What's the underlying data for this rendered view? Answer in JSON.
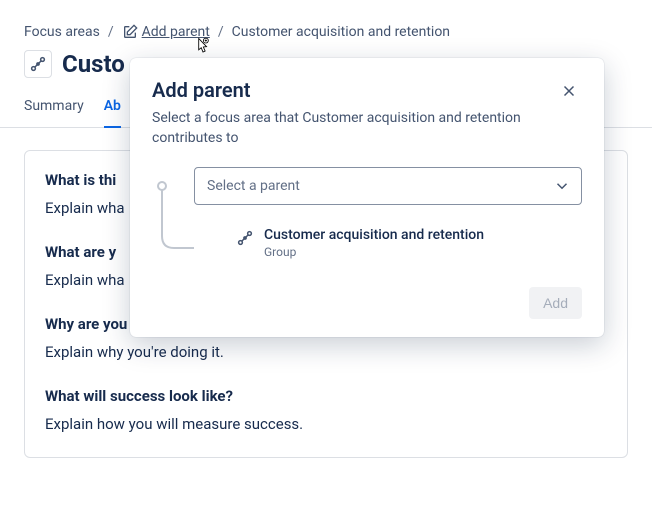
{
  "breadcrumb": {
    "root": "Focus areas",
    "add_parent": "Add parent",
    "current": "Customer acquisition and retention"
  },
  "title": "Customer acquisition and retention",
  "title_truncated": "Custo",
  "tabs": {
    "summary": "Summary",
    "about": "About",
    "about_truncated": "Ab"
  },
  "sections": [
    {
      "q": "What is this focus area?",
      "q_truncated": "What is thi",
      "a": "Explain what this focus area is.",
      "a_truncated": "Explain wha"
    },
    {
      "q": "What are you doing?",
      "q_truncated": "What are y",
      "a": "Explain what you're doing.",
      "a_truncated": "Explain wha"
    },
    {
      "q": "Why are you doing it?",
      "a": "Explain why you're doing it."
    },
    {
      "q": "What will success look like?",
      "a": "Explain how you will measure success."
    }
  ],
  "modal": {
    "title": "Add parent",
    "description": "Select a focus area that Customer acquisition and retention contributes to",
    "select_placeholder": "Select a parent",
    "child_name": "Customer acquisition and retention",
    "child_sub": "Group",
    "add_button": "Add"
  }
}
